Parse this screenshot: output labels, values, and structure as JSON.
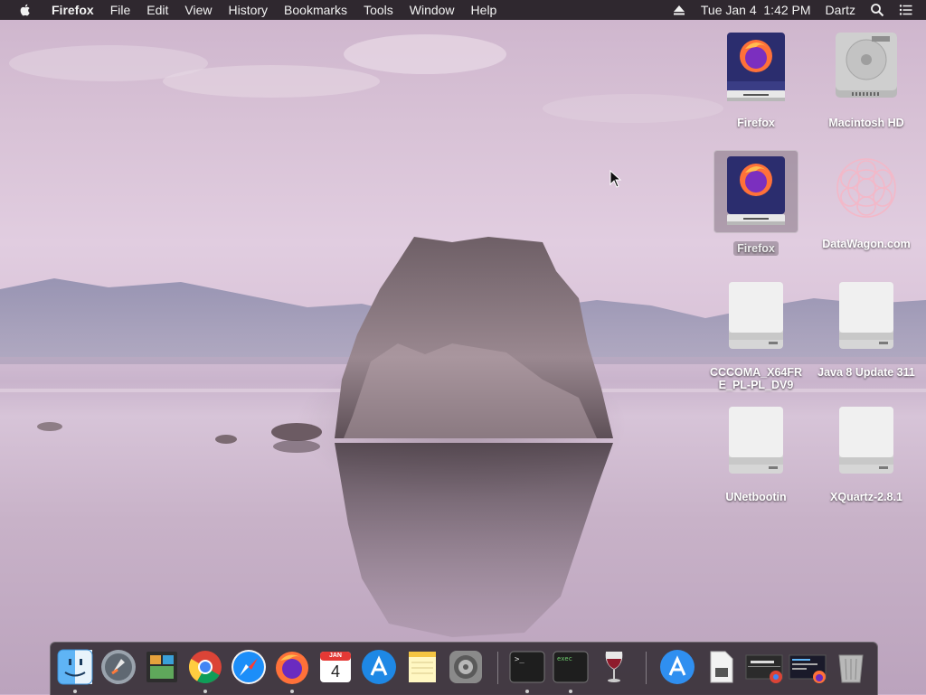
{
  "menubar": {
    "apple_icon": "apple-icon",
    "app_name": "Firefox",
    "menus": [
      "File",
      "Edit",
      "View",
      "History",
      "Bookmarks",
      "Tools",
      "Window",
      "Help"
    ],
    "eject_icon": "eject-icon",
    "datetime": "Tue Jan 4  1:42 PM",
    "user": "Dartz",
    "search_icon": "spotlight-search-icon",
    "list_icon": "notification-center-icon"
  },
  "desktop": {
    "icons": [
      {
        "label": "Firefox",
        "kind": "firefox-disk",
        "selected": false
      },
      {
        "label": "Macintosh HD",
        "kind": "hard-drive",
        "selected": false
      },
      {
        "label": "Firefox",
        "kind": "firefox-disk",
        "selected": true
      },
      {
        "label": "DataWagon.com",
        "kind": "flower-logo",
        "selected": false
      },
      {
        "label": "CCCOMA_X64FRE_PL-PL_DV9",
        "kind": "external-drive",
        "selected": false
      },
      {
        "label": "Java 8 Update 311",
        "kind": "external-drive",
        "selected": false
      },
      {
        "label": "UNetbootin",
        "kind": "external-drive",
        "selected": false
      },
      {
        "label": "XQuartz-2.8.1",
        "kind": "external-drive",
        "selected": false
      }
    ]
  },
  "dock": {
    "items": [
      {
        "name": "finder-icon",
        "running": true
      },
      {
        "name": "launchpad-icon",
        "running": false
      },
      {
        "name": "photo-slideshow-icon",
        "running": false
      },
      {
        "name": "chrome-icon",
        "running": true
      },
      {
        "name": "safari-icon",
        "running": false
      },
      {
        "name": "firefox-icon",
        "running": true
      },
      {
        "name": "calendar-icon",
        "running": false
      },
      {
        "name": "app-store-icon",
        "running": false
      },
      {
        "name": "notes-icon",
        "running": false
      },
      {
        "name": "system-preferences-icon",
        "running": false
      },
      {
        "name": "terminal-icon",
        "running": true
      },
      {
        "name": "exec-terminal-icon",
        "running": true
      },
      {
        "name": "wine-icon",
        "running": false
      },
      {
        "name": "app-store-folder-icon",
        "running": false
      },
      {
        "name": "installer-disk-icon",
        "running": false
      },
      {
        "name": "chrome-window-icon",
        "running": false
      },
      {
        "name": "firefox-window-icon",
        "running": false
      },
      {
        "name": "trash-icon",
        "running": false
      }
    ],
    "calendar": {
      "month": "JAN",
      "day": "4"
    },
    "terminal_prompt": ">_",
    "exec_label": "exec"
  }
}
